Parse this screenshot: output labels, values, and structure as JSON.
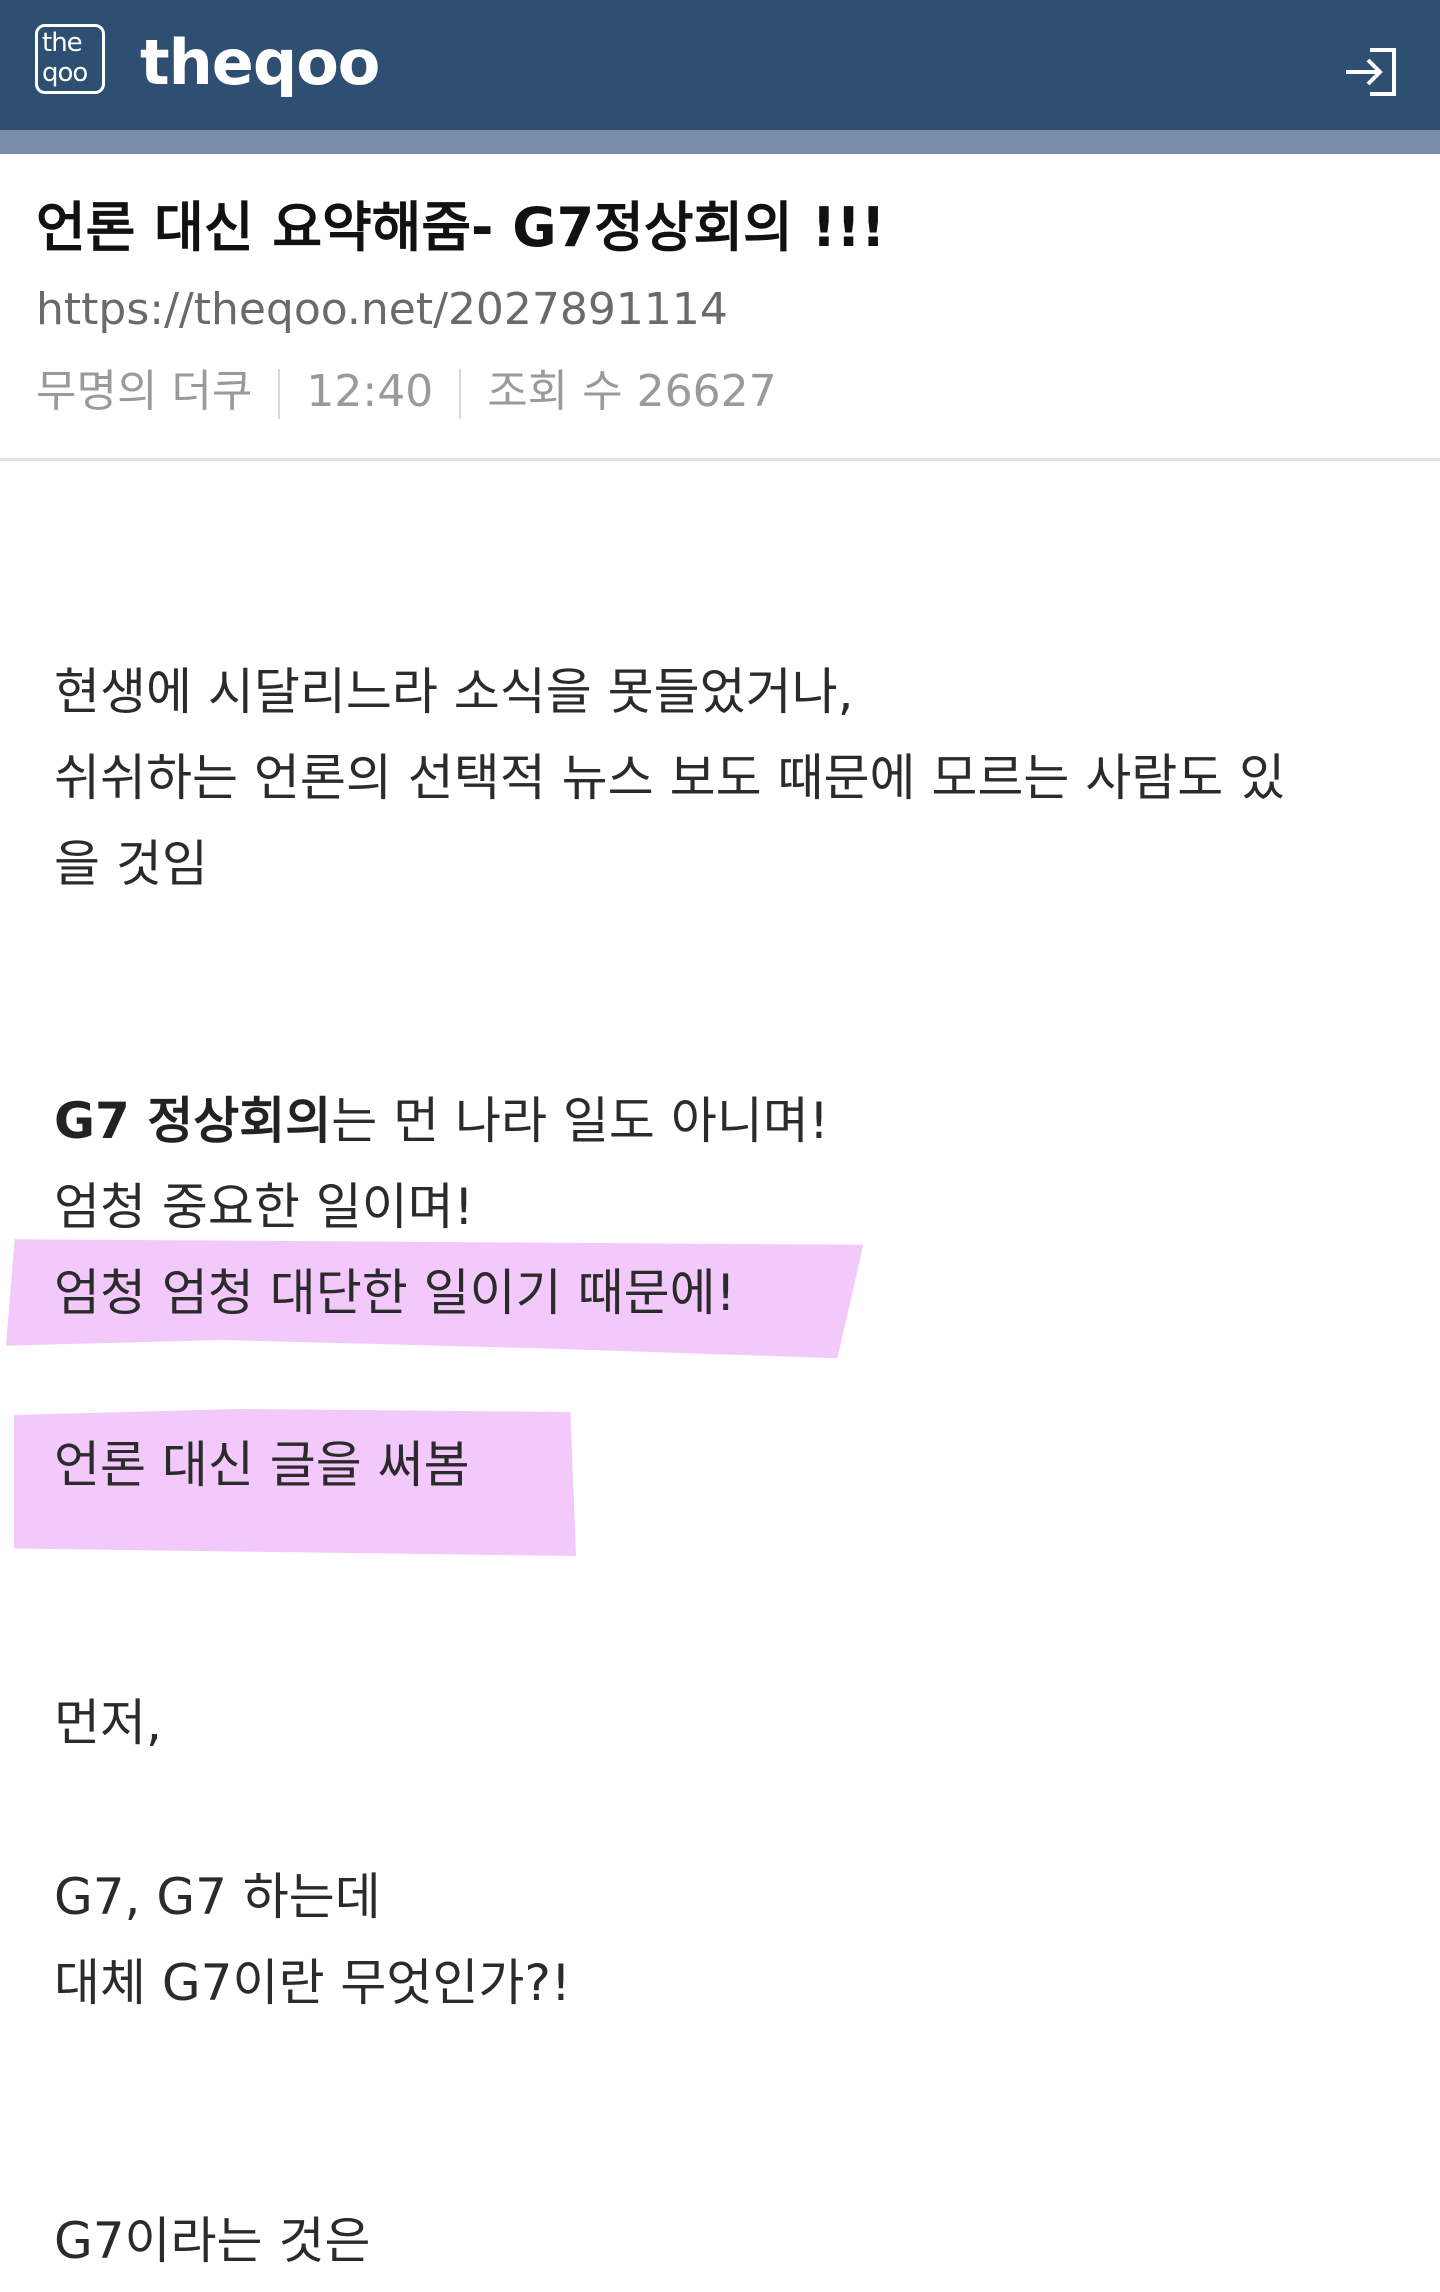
{
  "header": {
    "logo_line1": "the",
    "logo_line2": "qoo",
    "site_name": "theqoo",
    "login_icon": "login-arrow-icon"
  },
  "post": {
    "title": "언론 대신 요약해줌- G7정상회의 !!!",
    "url": "https://theqoo.net/2027891114",
    "author": "무명의 더쿠",
    "time": "12:40",
    "views_label": "조회 수",
    "views": "26627"
  },
  "body": {
    "para1_line1": "현생에 시달리느라 소식을 못들었거나,",
    "para1_line2": "쉬쉬하는 언론의 선택적 뉴스 보도 때문에 모르는 사람도 있",
    "para1_line3": "을 것임",
    "para2_bold": "G7 정상회의",
    "para2_line1_rest": "는 먼 나라 일도 아니며!",
    "para2_line2": "엄청 중요한 일이며!",
    "para2_line3": "엄청 엄청 대단한 일이기 때문에!",
    "para3": "언론 대신 글을 써봄",
    "para4": "먼저,",
    "para5_line1": "G7, G7 하는데",
    "para5_line2": "대체 G7이란 무엇인가?!",
    "para6": "G7이라는 것은"
  },
  "colors": {
    "header_bg": "#2f4f72",
    "header_strip": "#7b8ea8",
    "highlight": "#f3c8fb"
  }
}
